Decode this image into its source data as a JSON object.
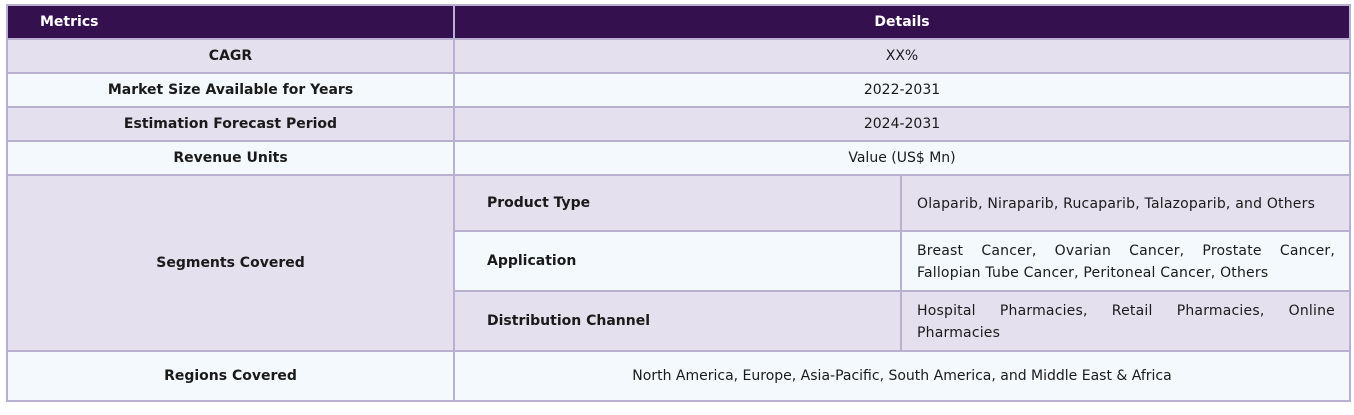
{
  "table": {
    "headers": {
      "metrics": "Metrics",
      "details": "Details"
    },
    "rows": [
      {
        "metric": "CAGR",
        "value": "XX%"
      },
      {
        "metric": "Market Size Available for Years",
        "value": "2022-2031"
      },
      {
        "metric": "Estimation Forecast Period",
        "value": "2024-2031"
      },
      {
        "metric": "Revenue Units",
        "value": "Value (US$ Mn)"
      }
    ],
    "segments": {
      "label": "Segments Covered",
      "items": [
        {
          "name": "Product Type",
          "value": "Olaparib, Niraparib, Rucaparib, Talazoparib, and Others"
        },
        {
          "name": "Application",
          "value": "Breast Cancer, Ovarian Cancer, Prostate Cancer, Fallopian Tube Cancer, Peritoneal Cancer, Others"
        },
        {
          "name": "Distribution Channel",
          "value": "Hospital Pharmacies, Retail Pharmacies, Online Pharmacies"
        }
      ]
    },
    "regions": {
      "metric": "Regions Covered",
      "value": "North America, Europe, Asia-Pacific, South America, and Middle East & Africa"
    }
  }
}
